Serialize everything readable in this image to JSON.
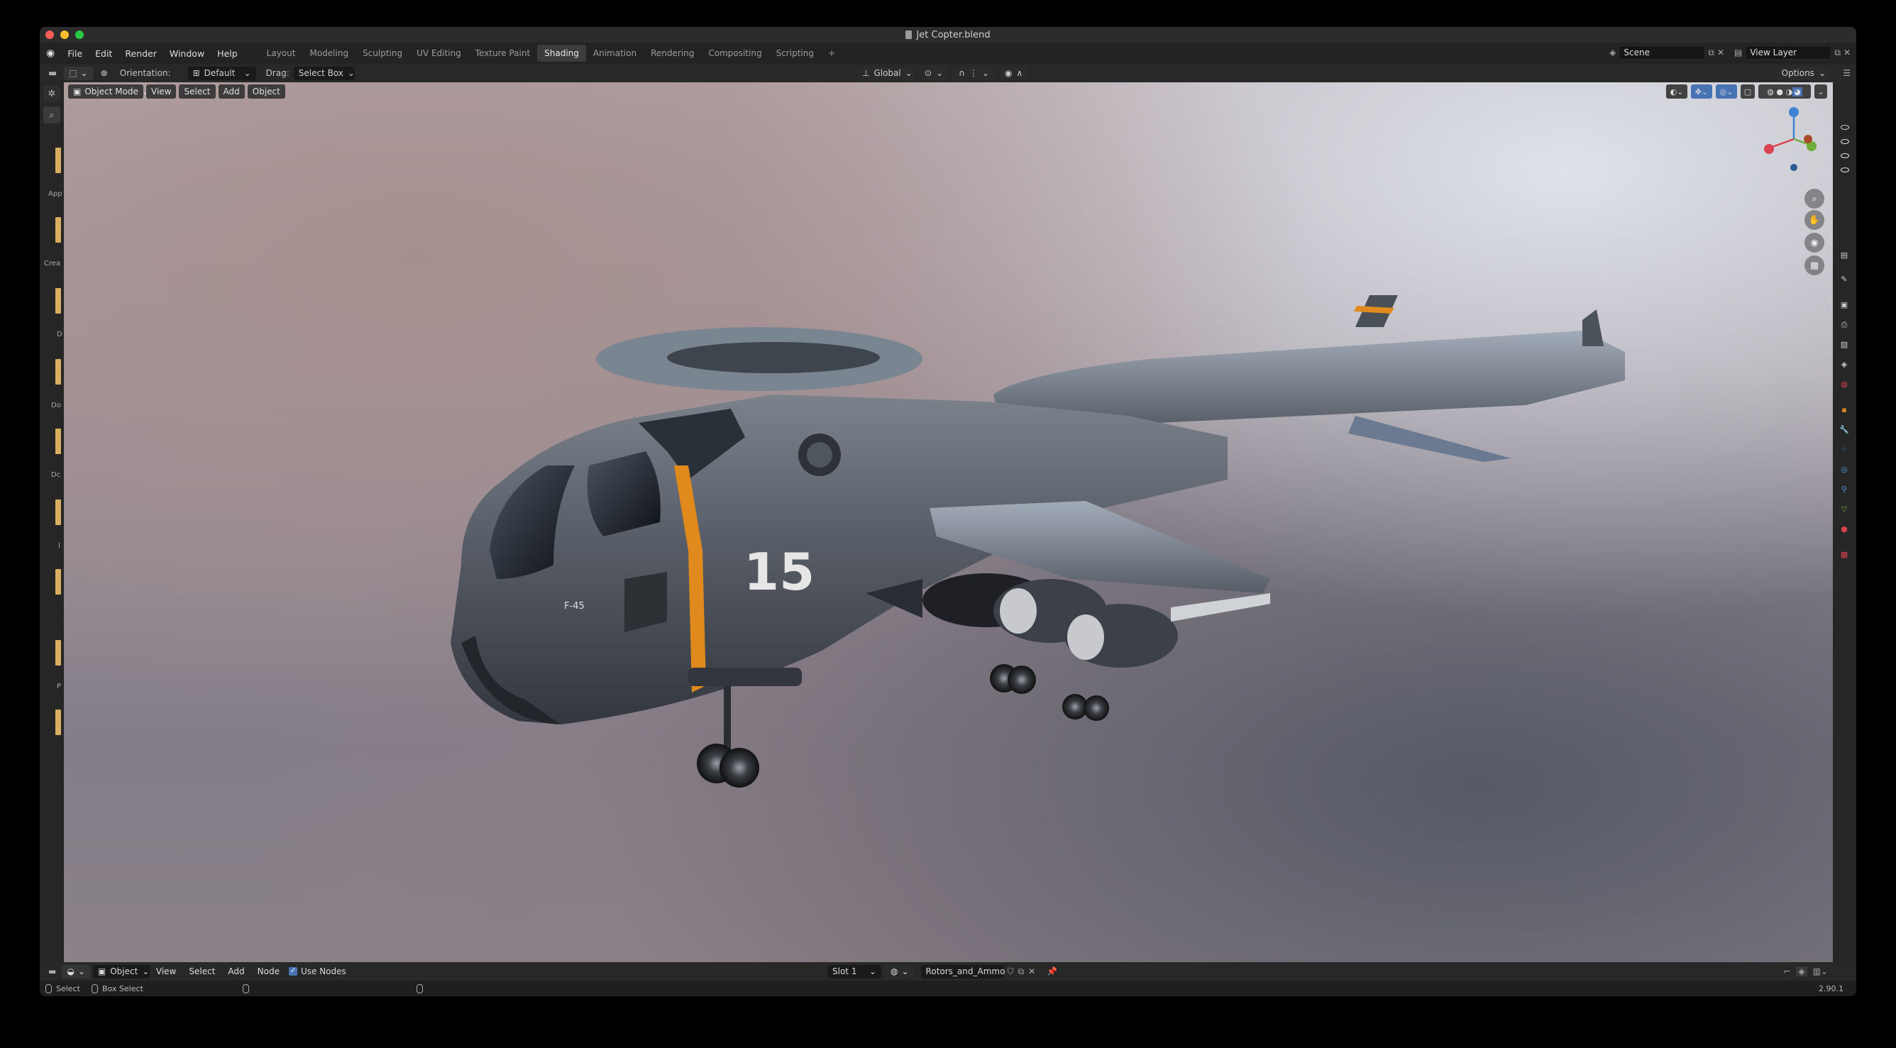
{
  "window": {
    "title": "Jet Copter.blend"
  },
  "menu": {
    "items": [
      "File",
      "Edit",
      "Render",
      "Window",
      "Help"
    ]
  },
  "workspaces": {
    "tabs": [
      "Layout",
      "Modeling",
      "Sculpting",
      "UV Editing",
      "Texture Paint",
      "Shading",
      "Animation",
      "Rendering",
      "Compositing",
      "Scripting"
    ],
    "active": "Shading",
    "add_label": "+"
  },
  "scene": {
    "name": "Scene",
    "view_layer": "View Layer"
  },
  "tool_header": {
    "orientation_label": "Orientation:",
    "orientation_value": "Default",
    "drag_label": "Drag:",
    "drag_value": "Select Box",
    "transform_orientation": "Global",
    "options_label": "Options"
  },
  "viewport_header": {
    "mode": "Object Mode",
    "menus": [
      "View",
      "Select",
      "Add",
      "Object"
    ]
  },
  "asset_strip": {
    "labels": [
      "App",
      "Crea",
      "D",
      "Do",
      "Dc",
      "l",
      "P"
    ]
  },
  "node_header": {
    "editor_type": "Object",
    "menus": [
      "View",
      "Select",
      "Add",
      "Node"
    ],
    "use_nodes_label": "Use Nodes",
    "slot": "Slot 1",
    "material": "Rotors_and_Ammo"
  },
  "statusbar": {
    "select_label": "Select",
    "box_select_label": "Box Select",
    "version": "2.90.1"
  },
  "aircraft": {
    "tail_number": "15",
    "model_marking": "F-45"
  },
  "colors": {
    "accent_blue": "#4772b3",
    "close": "#ff5f57",
    "minimize": "#febc2e",
    "zoom": "#28c840",
    "stripe_orange": "#e08a1e",
    "x_axis": "#d9434f",
    "y_axis": "#6fad3a",
    "z_axis": "#3d82d4"
  }
}
